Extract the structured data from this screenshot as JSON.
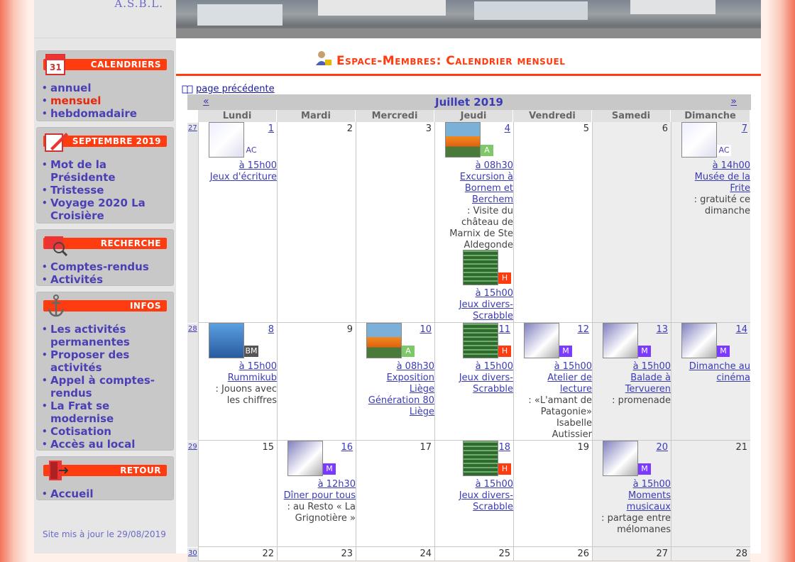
{
  "sidebar": {
    "asbl": "A.S.B.L.",
    "sections": [
      {
        "title": "CALENDRIERS",
        "items": [
          {
            "label": "annuel"
          },
          {
            "label": "mensuel",
            "active": true
          },
          {
            "label": "hebdomadaire"
          }
        ]
      },
      {
        "title": "SEPTEMBRE 2019",
        "items": [
          {
            "label": "Mot de la Présidente"
          },
          {
            "label": "Tristesse"
          },
          {
            "label": "Voyage 2020 La Croisière"
          }
        ]
      },
      {
        "title": "RECHERCHE",
        "items": [
          {
            "label": "Comptes-rendus"
          },
          {
            "label": "Activités"
          }
        ]
      },
      {
        "title": "INFOS",
        "items": [
          {
            "label": "Les activités permanentes"
          },
          {
            "label": "Proposer des activités"
          },
          {
            "label": "Appel à comptes-rendus"
          },
          {
            "label": "La Frat se modernise"
          },
          {
            "label": "Cotisation"
          },
          {
            "label": "Accès au local"
          }
        ]
      },
      {
        "title": "RETOUR",
        "items": [
          {
            "label": "Accueil"
          }
        ]
      }
    ],
    "updated": "Site mis à jour le 29/08/2019"
  },
  "page": {
    "title": "Espace-Membres: Calendrier mensuel",
    "prev_link": "page précédente"
  },
  "calendar": {
    "prev": "«",
    "next": "»",
    "month": "Juillet 2019",
    "days": [
      "Lundi",
      "Mardi",
      "Mercredi",
      "Jeudi",
      "Vendredi",
      "Samedi",
      "Dimanche"
    ],
    "weeks": [
      {
        "num": "27",
        "cells": [
          {
            "d": "1",
            "ev": {
              "badge": "AC",
              "time": "à 15h00",
              "title": "Jeux d'écriture"
            }
          },
          {
            "d": "2"
          },
          {
            "d": "3"
          },
          {
            "d": "4",
            "ev": {
              "badge": "A",
              "time": "à 08h30",
              "title": "Excursion à Bornem et Berchem",
              "desc": ": Visite du château de Marnix de Ste Aldegonde"
            },
            "ev2": {
              "badge": "H",
              "time": "à 15h00",
              "title": "Jeux divers-Scrabble"
            }
          },
          {
            "d": "5"
          },
          {
            "d": "6"
          },
          {
            "d": "7",
            "ev": {
              "badge": "AC",
              "time": "à 14h00",
              "title": "Musée de la Frite",
              "desc": ": gratuité ce dimanche"
            }
          }
        ]
      },
      {
        "num": "28",
        "cells": [
          {
            "d": "8",
            "ev": {
              "badge": "BM",
              "time": "à 15h00",
              "title": "Rummikub",
              "desc": ": Jouons avec les chiffres"
            }
          },
          {
            "d": "9"
          },
          {
            "d": "10",
            "ev": {
              "badge": "A",
              "time": "à 08h30",
              "title": "Exposition Liège Génération 80 Liège"
            }
          },
          {
            "d": "11",
            "ev": {
              "badge": "H",
              "time": "à 15h00",
              "title": "Jeux divers-Scrabble"
            }
          },
          {
            "d": "12",
            "ev": {
              "badge": "M",
              "time": "à 15h00",
              "title": "Atelier de lecture",
              "desc": ": «L'amant de Patagonie» Isabelle Autissier"
            }
          },
          {
            "d": "13",
            "ev": {
              "badge": "M",
              "time": "à 15h00",
              "title": "Balade à Tervueren",
              "desc": ": promenade"
            }
          },
          {
            "d": "14",
            "ev": {
              "badge": "M",
              "title": "Dimanche au cinéma"
            }
          }
        ]
      },
      {
        "num": "29",
        "cells": [
          {
            "d": "15"
          },
          {
            "d": "16",
            "ev": {
              "badge": "M",
              "time": "à 12h30",
              "title": "Dîner pour tous",
              "desc": ": au Resto « La Grignotière »"
            }
          },
          {
            "d": "17"
          },
          {
            "d": "18",
            "ev": {
              "badge": "H",
              "time": "à 15h00",
              "title": "Jeux divers-Scrabble"
            }
          },
          {
            "d": "19"
          },
          {
            "d": "20",
            "ev": {
              "badge": "M",
              "time": "à 15h00",
              "title": "Moments musicaux",
              "desc": ": partage entre mélomanes"
            }
          },
          {
            "d": "21"
          }
        ]
      },
      {
        "num": "30",
        "cells": [
          {
            "d": "22"
          },
          {
            "d": "23"
          },
          {
            "d": "24"
          },
          {
            "d": "25"
          },
          {
            "d": "26"
          },
          {
            "d": "27"
          },
          {
            "d": "28"
          }
        ]
      }
    ]
  }
}
